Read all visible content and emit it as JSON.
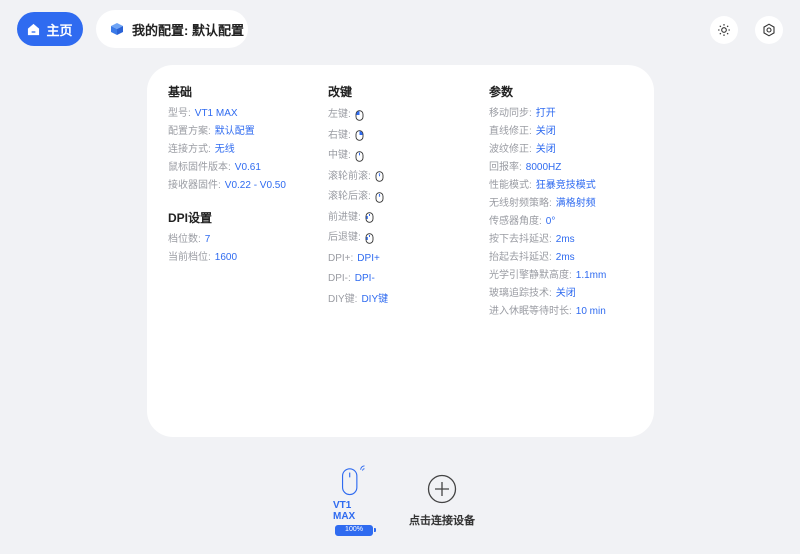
{
  "header": {
    "home_label": "主页",
    "config_label": "我的配置: 默认配置"
  },
  "basic": {
    "title": "基础",
    "rows": [
      {
        "label": "型号:",
        "value": "VT1 MAX"
      },
      {
        "label": "配置方案:",
        "value": "默认配置"
      },
      {
        "label": "连接方式:",
        "value": "无线"
      },
      {
        "label": "鼠标固件版本:",
        "value": "V0.61"
      },
      {
        "label": "接收器固件:",
        "value": "V0.22 - V0.50"
      }
    ]
  },
  "dpi": {
    "title": "DPI设置",
    "rows": [
      {
        "label": "档位数:",
        "value": "7"
      },
      {
        "label": "当前档位:",
        "value": "1600"
      }
    ]
  },
  "keys": {
    "title": "改键",
    "rows": [
      {
        "label": "左键:",
        "icon": "mouse-left-icon"
      },
      {
        "label": "右键:",
        "icon": "mouse-right-icon"
      },
      {
        "label": "中键:",
        "icon": "mouse-middle-icon"
      },
      {
        "label": "滚轮前滚:",
        "icon": "scroll-up-icon"
      },
      {
        "label": "滚轮后滚:",
        "icon": "scroll-down-icon"
      },
      {
        "label": "前进键:",
        "icon": "mouse-forward-icon"
      },
      {
        "label": "后退键:",
        "icon": "mouse-back-icon"
      },
      {
        "label": "DPI+:",
        "value": "DPI+"
      },
      {
        "label": "DPI-:",
        "value": "DPI-"
      },
      {
        "label": "DIY键:",
        "value": "DIY键"
      }
    ]
  },
  "params": {
    "title": "参数",
    "rows": [
      {
        "label": "移动同步:",
        "value": "打开"
      },
      {
        "label": "直线修正:",
        "value": "关闭"
      },
      {
        "label": "波纹修正:",
        "value": "关闭"
      },
      {
        "label": "回报率:",
        "value": "8000HZ"
      },
      {
        "label": "性能模式:",
        "value": "狂暴竞技模式"
      },
      {
        "label": "无线射频策略:",
        "value": "满格射频"
      },
      {
        "label": "传感器角度:",
        "value": "0°"
      },
      {
        "label": "按下去抖延迟:",
        "value": "2ms"
      },
      {
        "label": "抬起去抖延迟:",
        "value": "2ms"
      },
      {
        "label": "光学引擎静默高度:",
        "value": "1.1mm"
      },
      {
        "label": "玻璃追踪技术:",
        "value": "关闭"
      },
      {
        "label": "进入休眠等待时长:",
        "value": "10 min"
      }
    ]
  },
  "device": {
    "name": "VT1 MAX",
    "battery": "100%",
    "battery_level": 100
  },
  "add_device": {
    "label": "点击连接设备"
  },
  "colors": {
    "accent": "#2f6bf0",
    "label": "#9a9ca3",
    "background": "#f1f2f5"
  }
}
